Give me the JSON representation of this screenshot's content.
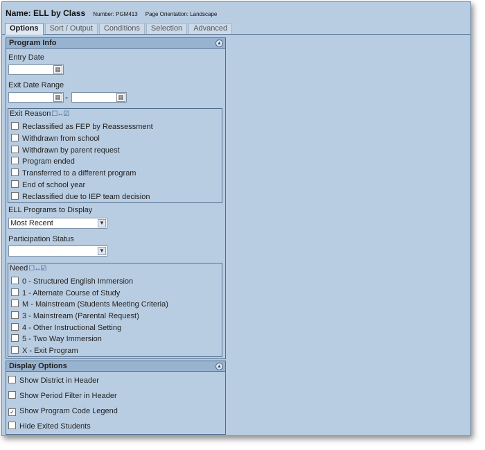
{
  "header": {
    "title": "Name: ELL by Class",
    "number": "Number: PGM413",
    "orientation": "Page Orientation: Landscape"
  },
  "tabs": [
    "Options",
    "Sort / Output",
    "Conditions",
    "Selection",
    "Advanced"
  ],
  "program_info": {
    "title": "Program Info",
    "entry_date_label": "Entry Date",
    "exit_range_label": "Exit Date Range",
    "range_sep": "-",
    "exit_reason": {
      "title": "Exit Reason",
      "items": [
        "Reclassified as FEP by Reassessment",
        "Withdrawn from school",
        "Withdrawn by parent request",
        "Program ended",
        "Transferred to a different program",
        "End of school year",
        "Reclassified due to IEP team decision"
      ]
    },
    "ell_programs_label": "ELL Programs to Display",
    "ell_programs_value": "Most Recent",
    "participation_label": "Participation Status",
    "participation_value": "",
    "need": {
      "title": "Need",
      "items": [
        "0 - Structured English Immersion",
        "1 - Alternate Course of Study",
        "M - Mainstream (Students Meeting Criteria)",
        "3 - Mainstream (Parental Request)",
        "4 - Other Instructional Setting",
        "5 - Two Way Immersion",
        "X - Exit Program"
      ]
    }
  },
  "display_options": {
    "title": "Display Options",
    "items": [
      {
        "label": "Show District in Header",
        "checked": false
      },
      {
        "label": "Show Period Filter in Header",
        "checked": false
      },
      {
        "label": "Show Program Code Legend",
        "checked": true
      },
      {
        "label": "Hide Exited Students",
        "checked": false
      }
    ]
  },
  "icons": {
    "collapse": "collapse-icon",
    "calendar": "calendar-icon",
    "dropdown": "chevron-down-icon",
    "select_toggle": "select-all-toggle-icon"
  }
}
